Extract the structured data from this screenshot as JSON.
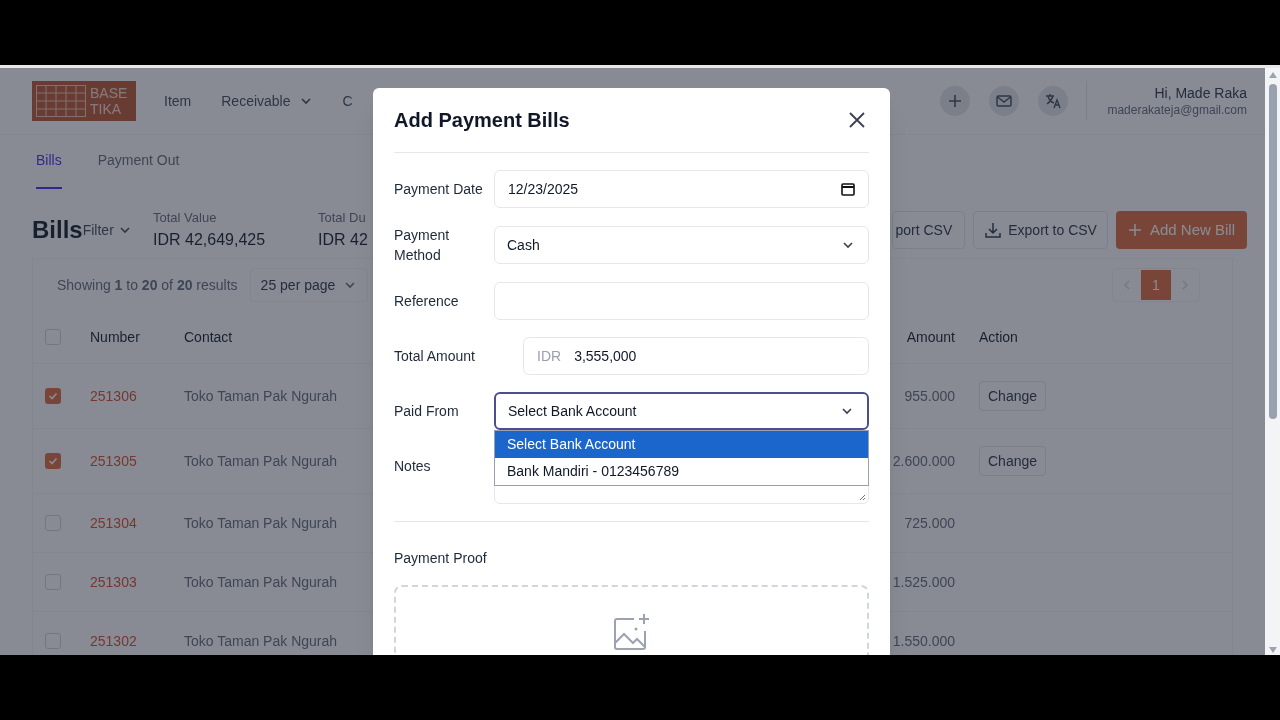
{
  "header": {
    "logo": {
      "line1": "BASE",
      "line2": "TIKA"
    },
    "nav": [
      {
        "label": "Item",
        "dropdown": false
      },
      {
        "label": "Receivable",
        "dropdown": true
      },
      {
        "label": "C",
        "dropdown": false
      }
    ],
    "user": {
      "greeting": "Hi, Made Raka",
      "email": "maderakateja@gmail.com"
    }
  },
  "tabs": [
    {
      "label": "Bills",
      "selected": true
    },
    {
      "label": "Payment Out",
      "selected": false
    }
  ],
  "page": {
    "title": "Bills",
    "filter": "Filter",
    "stats": [
      {
        "label": "Total Value",
        "value": "IDR 42,649,425"
      },
      {
        "label": "Total Du",
        "value": "IDR 42"
      }
    ],
    "buttons": [
      {
        "label": "port CSV",
        "kind": "outline"
      },
      {
        "label": "Export to CSV",
        "kind": "export"
      },
      {
        "label": "Add New Bill",
        "kind": "primary"
      }
    ]
  },
  "table": {
    "summary": "Showing **1** to **20** of **20** results",
    "per_page": "25 per page",
    "pages": [
      {
        "label": "1",
        "selected": true
      }
    ],
    "select_all_checked": false,
    "columns": [
      "Number",
      "Contact",
      "Amount",
      "Action"
    ],
    "rows": [
      {
        "number": "251306",
        "contact": "Toko Taman Pak Ngurah",
        "amount": "955.000",
        "checked": true,
        "action": "Change"
      },
      {
        "number": "251305",
        "contact": "Toko Taman Pak Ngurah",
        "amount": "2.600.000",
        "checked": true,
        "action": "Change"
      },
      {
        "number": "251304",
        "contact": "Toko Taman Pak Ngurah",
        "amount": "725.000",
        "checked": false
      },
      {
        "number": "251303",
        "contact": "Toko Taman Pak Ngurah",
        "amount": "1.525.000",
        "checked": false
      },
      {
        "number": "251302",
        "contact": "Toko Taman Pak Ngurah",
        "amount": "1.550.000",
        "checked": false
      }
    ]
  },
  "modal": {
    "title": "Add Payment Bills",
    "fields": [
      {
        "label": "Payment Date",
        "kind": "date",
        "value": "12/23/2025"
      },
      {
        "label": "Payment Method",
        "kind": "select",
        "value": "Cash",
        "focused": false
      },
      {
        "label": "Reference",
        "kind": "text"
      },
      {
        "label": "Total Amount",
        "kind": "currency",
        "prefix": "IDR",
        "value": "3,555,000"
      },
      {
        "label": "Paid From",
        "kind": "select",
        "value": "Select Bank Account",
        "focused": true,
        "options": [
          {
            "label": "Select Bank Account",
            "selected": true
          },
          {
            "label": "Bank Mandiri - 0123456789",
            "selected": false
          }
        ]
      },
      {
        "label": "Notes",
        "kind": "textarea"
      }
    ],
    "proof": {
      "label": "Payment Proof"
    }
  }
}
